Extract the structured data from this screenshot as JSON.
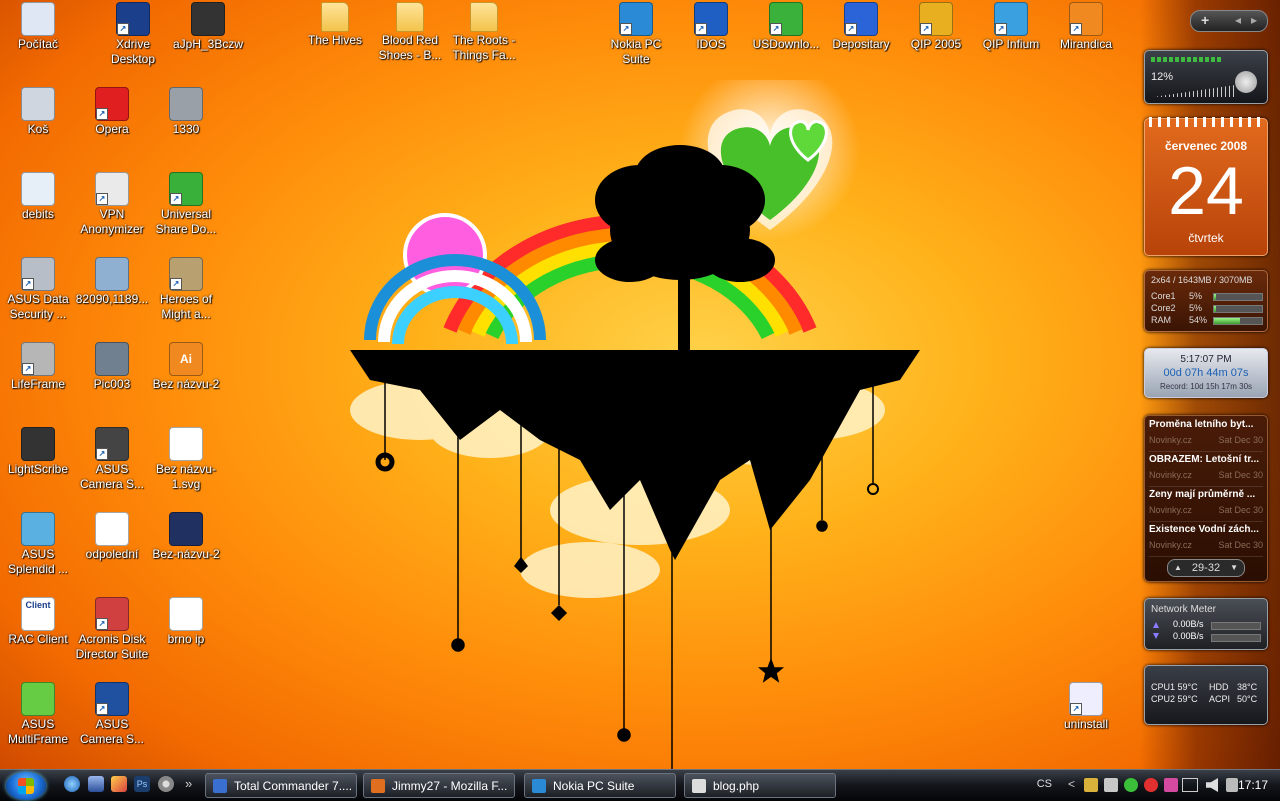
{
  "desktop_icons": [
    {
      "label": "Počítač",
      "x": "pc"
    },
    {
      "label": "Xdrive Desktop"
    },
    {
      "label": "aJpH_3Bczw"
    },
    {
      "label": "The Hives"
    },
    {
      "label": "Blood Red Shoes - B..."
    },
    {
      "label": "The Roots - Things Fa..."
    },
    {
      "label": "Nokia PC Suite"
    },
    {
      "label": "IDOS"
    },
    {
      "label": "USDownlo..."
    },
    {
      "label": "Depositary"
    },
    {
      "label": "QIP 2005"
    },
    {
      "label": "QIP Infium"
    },
    {
      "label": "Mirandica"
    },
    {
      "label": "Koš"
    },
    {
      "label": "Opera"
    },
    {
      "label": "1330"
    },
    {
      "label": "debits"
    },
    {
      "label": "VPN Anonymizer"
    },
    {
      "label": "Universal Share Do..."
    },
    {
      "label": "ASUS Data Security ..."
    },
    {
      "label": "82090,1189..."
    },
    {
      "label": "Heroes of Might a..."
    },
    {
      "label": "LifeFrame"
    },
    {
      "label": "Pic003"
    },
    {
      "label": "Bez názvu-2"
    },
    {
      "label": "LightScribe"
    },
    {
      "label": "ASUS Camera S..."
    },
    {
      "label": "Bez názvu-1.svg"
    },
    {
      "label": "ASUS Splendid ..."
    },
    {
      "label": "odpolední"
    },
    {
      "label": "Bez-názvu-2"
    },
    {
      "label": "RAC Client"
    },
    {
      "label": "Acronis Disk Director Suite"
    },
    {
      "label": "brno ip"
    },
    {
      "label": "ASUS MultiFrame"
    },
    {
      "label": "ASUS Camera S..."
    },
    {
      "label": "uninstall"
    }
  ],
  "icon_texts": {
    "rac": "Client",
    "ai": "Ai",
    "shortcut_arrow": "↗"
  },
  "sidebar": {
    "top_controls": {
      "add": "+",
      "prev": "◂",
      "next": "▸"
    },
    "volume": {
      "percent": "12%",
      "level": 0.12
    },
    "calendar": {
      "month": "červenec 2008",
      "day": "24",
      "weekday": "čtvrtek"
    },
    "cpu_meter": {
      "header": "2x64 / 1643MB / 3070MB",
      "rows": [
        {
          "label": "Core1",
          "value": "5%",
          "fill": 0.05
        },
        {
          "label": "Core2",
          "value": "5%",
          "fill": 0.05
        },
        {
          "label": "RAM",
          "value": "54%",
          "fill": 0.54
        }
      ]
    },
    "uptime": {
      "time": "5:17:07 PM",
      "uptime": "00d 07h 44m 07s",
      "record": "Record: 10d 15h 17m 30s"
    },
    "news": {
      "items": [
        {
          "title": "Proměna letního byt...",
          "source": "Novinky.cz",
          "date": "Sat Dec 30"
        },
        {
          "title": "OBRAZEM: Letošní tr...",
          "source": "Novinky.cz",
          "date": "Sat Dec 30"
        },
        {
          "title": "Ženy mají průměrně ...",
          "source": "Novinky.cz",
          "date": "Sat Dec 30"
        },
        {
          "title": "Existence Vodní zách...",
          "source": "Novinky.cz",
          "date": "Sat Dec 30"
        }
      ],
      "pager": "29-32",
      "up": "▲",
      "down": "▼"
    },
    "network": {
      "title": "Network Meter",
      "up": "0.00B/s",
      "down": "0.00B/s"
    },
    "temps": {
      "cpu1": "CPU1 59°C",
      "cpu2": "CPU2 59°C",
      "hdd": "HDD",
      "hdd_val": "38°C",
      "acpi": "ACPI",
      "acpi_val": "50°C"
    }
  },
  "taskbar": {
    "overflow": "»",
    "buttons": [
      {
        "label": "Total Commander 7...."
      },
      {
        "label": "Jimmy27 - Mozilla F..."
      },
      {
        "label": "Nokia PC Suite"
      },
      {
        "label": "blog.php"
      }
    ],
    "tray": {
      "lang": "CS",
      "chevron": "<",
      "clock": "17:17"
    }
  },
  "colors": {
    "accent": "#ff8c0a",
    "taskbar": "#12151a"
  }
}
